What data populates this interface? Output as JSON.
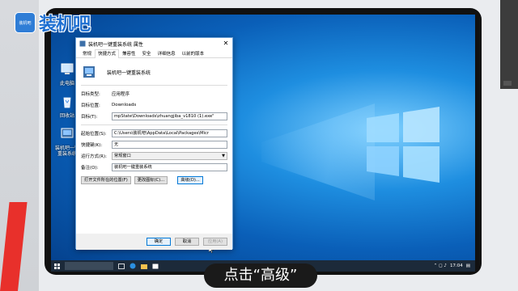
{
  "brand": {
    "badge_text": "装机吧",
    "word": "装机吧"
  },
  "desktop_icons": [
    {
      "label": "此电脑",
      "icon": "computer-icon"
    },
    {
      "label": "回收站",
      "icon": "recycle-bin-icon"
    },
    {
      "label": "装机吧一键重装系统",
      "icon": "app-shortcut-icon"
    }
  ],
  "dialog": {
    "title": "装机吧一键重装系统 属性",
    "close_glyph": "✕",
    "tabs": [
      "常规",
      "快捷方式",
      "兼容性",
      "安全",
      "详细信息",
      "以前的版本"
    ],
    "active_tab": "快捷方式",
    "app_name": "装机吧一键重装系统",
    "rows": {
      "target_type_label": "目标类型:",
      "target_type_value": "应用程序",
      "target_location_label": "目标位置:",
      "target_location_value": "Downloads",
      "target_label": "目标(T):",
      "target_value": "mpState\\Downloads\\zhuangjiba_v1810 (1).exe\"",
      "start_in_label": "起始位置(S):",
      "start_in_value": "C:\\Users\\装机吧\\AppData\\Local\\Packages\\Micr",
      "shortcut_key_label": "快捷键(K):",
      "shortcut_key_value": "无",
      "run_label": "运行方式(R):",
      "run_value": "常规窗口",
      "comment_label": "备注(O):",
      "comment_value": "装机吧一键重装系统"
    },
    "buttons": {
      "open_location": "打开文件所在的位置(F)",
      "change_icon": "更改图标(C)...",
      "advanced": "高级(D)..."
    },
    "footer": {
      "ok": "确定",
      "cancel": "取消",
      "apply": "应用(A)"
    }
  },
  "taskbar": {
    "time": "17:04"
  },
  "caption": "点击“高级”",
  "colors": {
    "accent": "#0078d7",
    "brand": "#1d6fd1",
    "red": "#e8302b"
  }
}
